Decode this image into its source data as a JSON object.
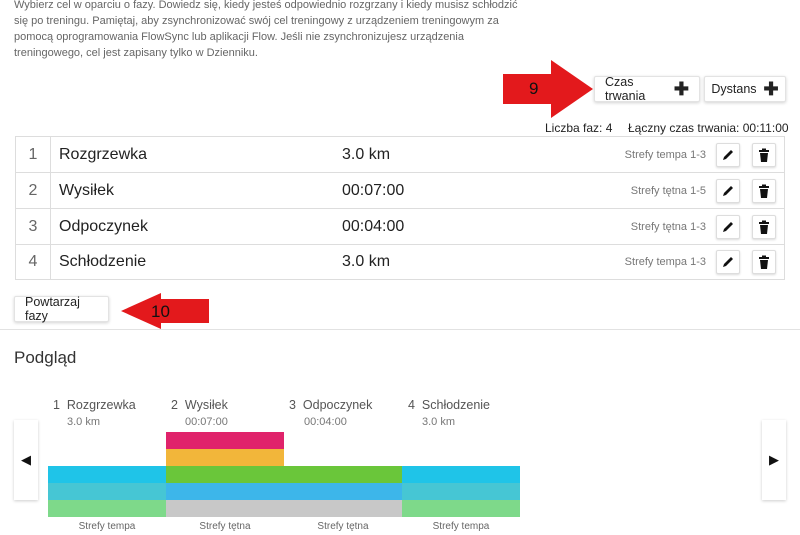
{
  "intro_text": "Wybierz cel w oparciu o fazy. Dowiedz się, kiedy jesteś odpowiednio rozgrzany i kiedy musisz schłodzić się po treningu. Pamiętaj, aby zsynchronizować swój cel treningowy z urządzeniem treningowym za pomocą oprogramowania FlowSync lub aplikacji Flow. Jeśli nie zsynchronizujesz urządzenia treningowego, cel jest zapisany tylko w Dzienniku.",
  "toolbar": {
    "duration_label": "Czas trwania",
    "distance_label": "Dystans"
  },
  "stats": {
    "phase_count": "Liczba faz: 4",
    "total_duration": "Łączny czas trwania: 00:11:00"
  },
  "phases": [
    {
      "num": "1",
      "name": "Rozgrzewka",
      "value": "3.0 km",
      "zone": "Strefy tempa 1-3"
    },
    {
      "num": "2",
      "name": "Wysiłek",
      "value": "00:07:00",
      "zone": "Strefy tętna 1-5"
    },
    {
      "num": "3",
      "name": "Odpoczynek",
      "value": "00:04:00",
      "zone": "Strefy tętna 1-3"
    },
    {
      "num": "4",
      "name": "Schłodzenie",
      "value": "3.0 km",
      "zone": "Strefy tempa 1-3"
    }
  ],
  "repeat_label": "Powtarzaj fazy",
  "annotations": {
    "a9": "9",
    "a10": "10"
  },
  "preview": {
    "title": "Podgląd",
    "phases": [
      {
        "num": "1",
        "name": "Rozgrzewka",
        "sub": "3.0 km",
        "zone_label": "Strefy tempa"
      },
      {
        "num": "2",
        "name": "Wysiłek",
        "sub": "00:07:00",
        "zone_label": "Strefy tętna"
      },
      {
        "num": "3",
        "name": "Odpoczynek",
        "sub": "00:04:00",
        "zone_label": "Strefy tętna"
      },
      {
        "num": "4",
        "name": "Schłodzenie",
        "sub": "3.0 km",
        "zone_label": "Strefy tempa"
      }
    ]
  },
  "colors": {
    "pace_zones": [
      "#7ed98a",
      "#46c6d4",
      "#1fc4e8"
    ],
    "hr_zones": [
      "#c8c8c8",
      "#3db6ea",
      "#6ac63a",
      "#f2b63a",
      "#e0236b"
    ],
    "annotation_red": "#e3191c"
  }
}
